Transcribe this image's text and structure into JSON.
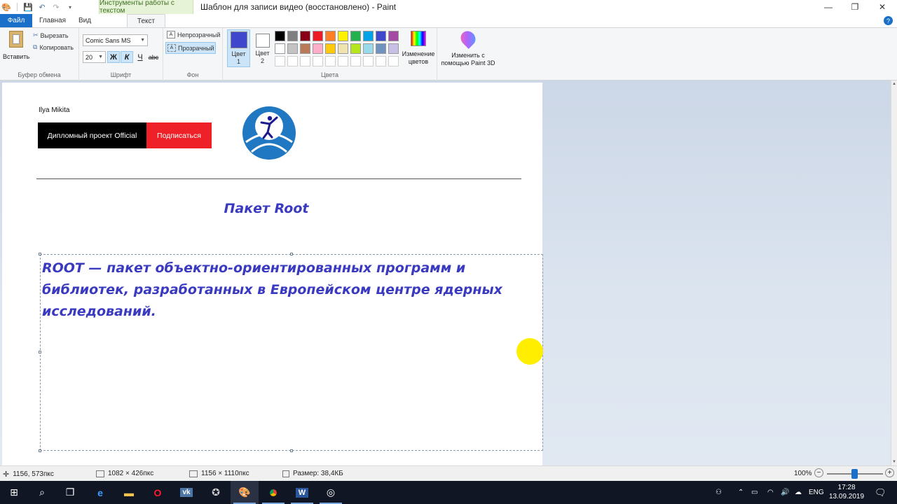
{
  "window": {
    "title": "Шаблон для записи видео (восстановлено) - Paint",
    "context_tab": "Инструменты работы с текстом"
  },
  "tabs": {
    "file": "Файл",
    "home": "Главная",
    "view": "Вид",
    "text": "Текст"
  },
  "clipboard": {
    "paste": "Вставить",
    "cut": "Вырезать",
    "copy": "Копировать",
    "group": "Буфер обмена"
  },
  "font": {
    "family": "Comic Sans MS",
    "size": "20",
    "bold": "Ж",
    "italic": "К",
    "underline": "Ч",
    "strike": "abc",
    "group": "Шрифт"
  },
  "background": {
    "opaque": "Непрозрачный",
    "transparent": "Прозрачный",
    "group": "Фон"
  },
  "colors": {
    "color1": "Цвет 1",
    "color2": "Цвет 2",
    "edit": "Изменение цветов",
    "group": "Цвета",
    "color1_value": "#3f48cc",
    "color2_value": "#ffffff",
    "palette_row1": [
      "#000000",
      "#7f7f7f",
      "#880015",
      "#ed1c24",
      "#ff7f27",
      "#fff200",
      "#22b14c",
      "#00a2e8",
      "#3f48cc",
      "#a349a4"
    ],
    "palette_row2": [
      "#ffffff",
      "#c3c3c3",
      "#b97a57",
      "#ffaec9",
      "#ffc90e",
      "#efe4b0",
      "#b5e61d",
      "#99d9ea",
      "#7092be",
      "#c8bfe7"
    ]
  },
  "paint3d": {
    "label": "Изменить с помощью Paint 3D"
  },
  "canvas": {
    "channel_name": "Ilya Mikita",
    "channel_button": "Дипломный проект Official",
    "subscribe_button": "Подписаться",
    "heading": "Пакет Root",
    "body_lines": [
      "ROOT — пакет объектно-ориентированных программ и",
      "библиотек, разработанных в Европейском центре ядерных",
      "исследований."
    ]
  },
  "status": {
    "cursor_pos": "1156, 573пкс",
    "selection_size": "1082 × 426пкс",
    "image_size": "1156 × 1110пкс",
    "file_size": "Размер: 38,4КБ",
    "zoom": "100%"
  },
  "taskbar": {
    "lang": "ENG",
    "time": "17:28",
    "date": "13.09.2019"
  }
}
